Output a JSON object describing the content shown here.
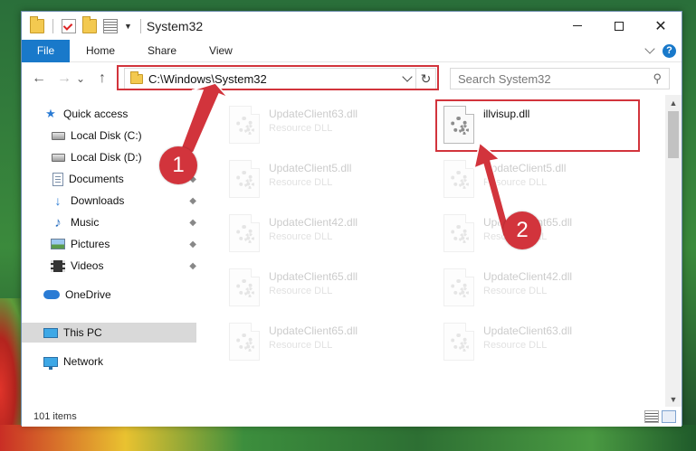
{
  "window": {
    "title": "System32"
  },
  "caption_buttons": {
    "minimize": "—",
    "maximize": "",
    "close": "✕"
  },
  "ribbon": {
    "tabs": [
      "File",
      "Home",
      "Share",
      "View"
    ],
    "help": "?"
  },
  "nav": {
    "back": "←",
    "forward": "→",
    "recent": "⌄",
    "up": "↑"
  },
  "address": {
    "path": "C:\\Windows\\System32",
    "refresh": "↻"
  },
  "search": {
    "placeholder": "Search System32",
    "icon": "⚲"
  },
  "sidebar": {
    "items": [
      {
        "label": "Quick access",
        "icon": "star-icon"
      },
      {
        "label": "Local Disk (C:)",
        "icon": "drive-icon"
      },
      {
        "label": "Local Disk (D:)",
        "icon": "drive-icon"
      },
      {
        "label": "Documents",
        "icon": "documents-icon",
        "pinned": true
      },
      {
        "label": "Downloads",
        "icon": "download-icon",
        "pinned": true
      },
      {
        "label": "Music",
        "icon": "music-icon",
        "pinned": true
      },
      {
        "label": "Pictures",
        "icon": "pictures-icon",
        "pinned": true
      },
      {
        "label": "Videos",
        "icon": "videos-icon",
        "pinned": true
      },
      {
        "label": "OneDrive",
        "icon": "cloud-icon"
      },
      {
        "label": "This PC",
        "icon": "computer-icon",
        "selected": true
      },
      {
        "label": "Network",
        "icon": "network-icon"
      }
    ],
    "pin_glyph": "📌"
  },
  "files": [
    {
      "name": "UpdateClient63.dll",
      "type": "Resource DLL",
      "faded": true
    },
    {
      "name": "illvisup.dll",
      "type": "",
      "faded": false,
      "highlighted": true
    },
    {
      "name": "UpdateClient5.dll",
      "type": "Resource DLL",
      "faded": true
    },
    {
      "name": "UpdateClient5.dll",
      "type": "Resource DLL",
      "faded": true
    },
    {
      "name": "UpdateClient42.dll",
      "type": "Resource DLL",
      "faded": true
    },
    {
      "name": "UpdateClient65.dll",
      "type": "Resource DLL",
      "faded": true
    },
    {
      "name": "UpdateClient65.dll",
      "type": "Resource DLL",
      "faded": true
    },
    {
      "name": "UpdateClient42.dll",
      "type": "Resource DLL",
      "faded": true
    },
    {
      "name": "UpdateClient65.dll",
      "type": "Resource DLL",
      "faded": true
    },
    {
      "name": "UpdateClient63.dll",
      "type": "Resource DLL",
      "faded": true
    }
  ],
  "status": {
    "item_count": "101 items"
  },
  "callouts": {
    "step1": "1",
    "step2": "2",
    "color": "#d2343c"
  },
  "accent_color": "#1979ca"
}
